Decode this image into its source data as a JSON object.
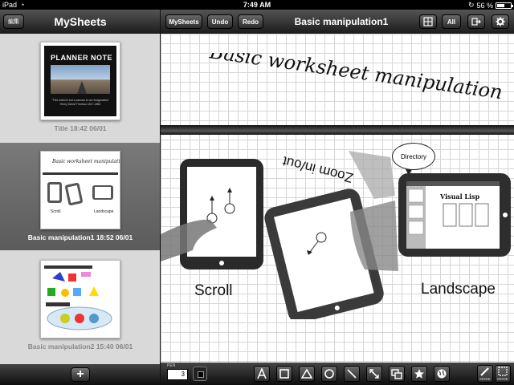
{
  "status": {
    "carrier": "iPad",
    "time": "7:49 AM",
    "battery": "56 %",
    "battery_level": 0.56
  },
  "sidebar": {
    "edit_label": "編集",
    "title": "MySheets",
    "add_label": "+",
    "sheets": [
      {
        "caption": "Title 18:42 06/01",
        "brand": "PLANNER NOTE",
        "quote": "\"This world is but a canvas to our imagination\" Henry David Thoreau 1817-1862"
      },
      {
        "caption": "Basic manipulation1 18:52 06/01",
        "selected": true
      },
      {
        "caption": "Basic manipulation2 15:40 06/01"
      }
    ]
  },
  "toolbar": {
    "mysheets_label": "MySheets",
    "undo_label": "Undo",
    "redo_label": "Redo",
    "title": "Basic manipulation1",
    "all_label": "All"
  },
  "canvas": {
    "heading": "Basic worksheet manipulation",
    "scroll_label": "Scroll",
    "zoom_label": "Zoom in/out",
    "landscape_label": "Landscape",
    "directory_label": "Directory",
    "mini_app_title": "Visual Lisp"
  },
  "bottombar": {
    "pen_label": "PEN",
    "pen_size": "3",
    "mode1": "MODE",
    "mode2": "MODE",
    "tools": [
      "text-tool-icon",
      "rectangle-tool-icon",
      "triangle-tool-icon",
      "circle-tool-icon",
      "line-tool-icon",
      "arrow-tool-icon",
      "group-tool-icon",
      "star-tool-icon",
      "globe-tool-icon"
    ]
  }
}
